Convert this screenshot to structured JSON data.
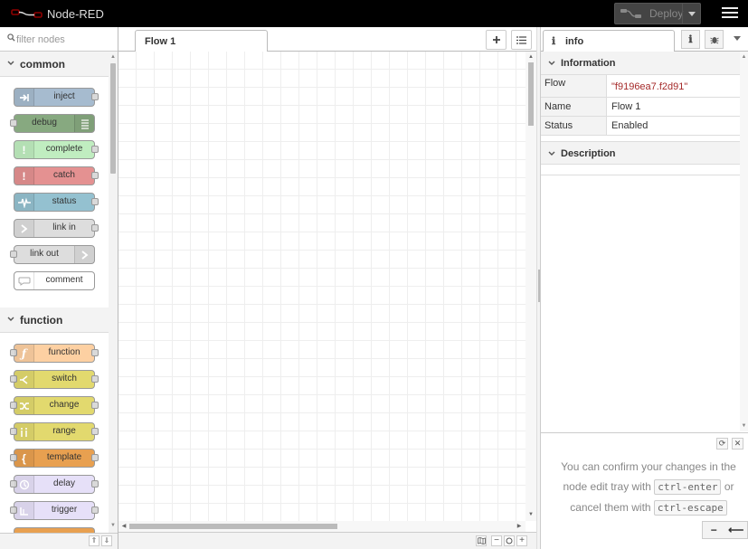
{
  "header": {
    "title": "Node-RED",
    "deploy_label": "Deploy"
  },
  "palette": {
    "search_placeholder": "filter nodes",
    "categories": [
      {
        "label": "common",
        "nodes": [
          {
            "label": "inject",
            "color": "#a6bbcf"
          },
          {
            "label": "debug",
            "color": "#87a980"
          },
          {
            "label": "complete",
            "color": "#c0edc0"
          },
          {
            "label": "catch",
            "color": "#e49191"
          },
          {
            "label": "status",
            "color": "#94c1d0"
          },
          {
            "label": "link in",
            "color": "#dddddd"
          },
          {
            "label": "link out",
            "color": "#dddddd"
          },
          {
            "label": "comment",
            "color": "#ffffff"
          }
        ]
      },
      {
        "label": "function",
        "nodes": [
          {
            "label": "function",
            "color": "#fdd0a2"
          },
          {
            "label": "switch",
            "color": "#e2d96e"
          },
          {
            "label": "change",
            "color": "#e2d96e"
          },
          {
            "label": "range",
            "color": "#e2d96e"
          },
          {
            "label": "template",
            "color": "#e8a050"
          },
          {
            "label": "delay",
            "color": "#e6e0f8"
          },
          {
            "label": "trigger",
            "color": "#e6e0f8"
          }
        ]
      }
    ]
  },
  "workspace": {
    "tabs": [
      {
        "label": "Flow 1"
      }
    ],
    "add_flow_icon": "plus-icon",
    "flow_list_icon": "list-icon"
  },
  "sidebar": {
    "active_tab": "info",
    "info_section_label": "Information",
    "info_rows": [
      {
        "key": "Flow",
        "value": "\"f9196ea7.f2d91\""
      },
      {
        "key": "Name",
        "value": "Flow 1"
      },
      {
        "key": "Status",
        "value": "Enabled"
      }
    ],
    "description_label": "Description",
    "help": {
      "line1": "You can confirm your changes in the node edit tray with",
      "confirm_key": "ctrl-enter",
      "line2": "or cancel them with",
      "cancel_key": "ctrl-escape"
    }
  },
  "colors": {
    "header_bg": "#000000",
    "palette_bg": "#f3f3f3",
    "flow_id_color": "#a52a2a"
  }
}
